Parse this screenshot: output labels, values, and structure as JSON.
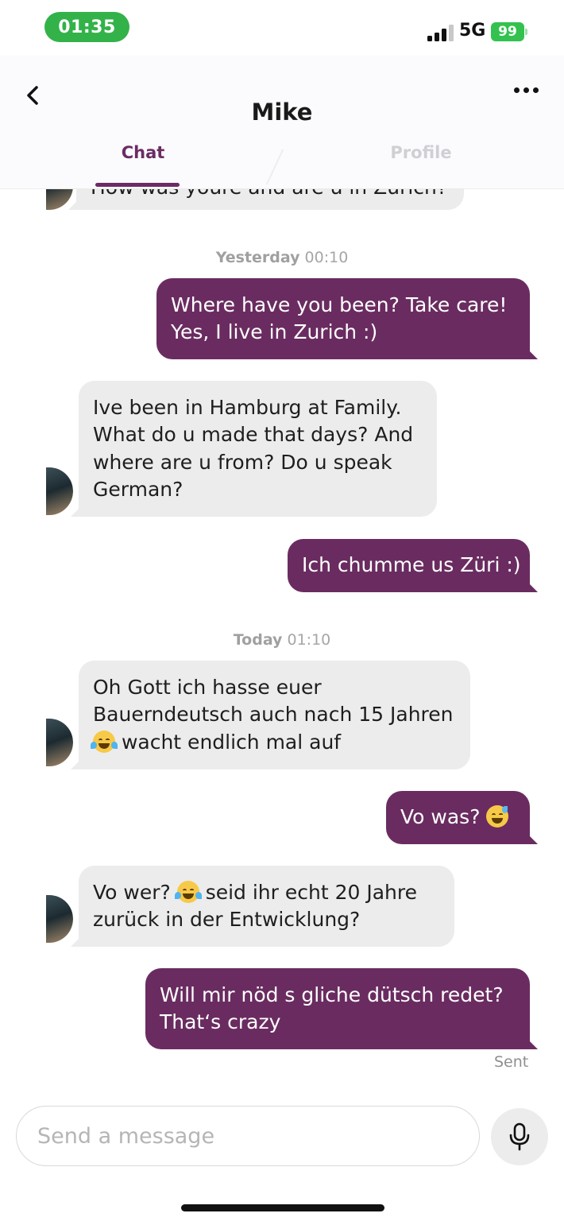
{
  "status_bar": {
    "time": "01:35",
    "network": "5G",
    "battery": "99"
  },
  "header": {
    "title": "Mike",
    "tabs": [
      {
        "label": "Chat",
        "active": true
      },
      {
        "label": "Profile",
        "active": false
      }
    ]
  },
  "timestamps": [
    {
      "day": "Yesterday",
      "time": "00:10"
    },
    {
      "day": "Today",
      "time": "01:10"
    }
  ],
  "messages": [
    {
      "from": "them",
      "lines": [
        "How was youre and are u in Zurich?"
      ]
    },
    {
      "from": "me",
      "lines": [
        "Where have you been? Take care!",
        "Yes, I live in Zurich :)"
      ]
    },
    {
      "from": "them",
      "lines": [
        "Ive been in Hamburg at Family.",
        "What do u made that days? And",
        "where are u from? Do u speak",
        "German?"
      ]
    },
    {
      "from": "me",
      "lines": [
        "Ich chumme us Züri :)"
      ]
    },
    {
      "from": "them",
      "lines": [
        "Oh Gott ich hasse euer",
        "Bauerndeutsch auch nach 15 Jahren",
        "wacht endlich mal auf"
      ],
      "emoji": "face-with-tears-of-joy"
    },
    {
      "from": "me",
      "lines": [
        "Vo was?"
      ],
      "emoji": "grinning-face-with-sweat"
    },
    {
      "from": "them",
      "lines": [
        "Vo wer?",
        "seid ihr echt 20 Jahre",
        "zurück in der Entwicklung?"
      ],
      "emoji": "face-with-tears-of-joy"
    },
    {
      "from": "me",
      "lines": [
        "Will mir nöd s gliche dütsch redet?",
        "That‘s crazy"
      ]
    }
  ],
  "delivery_status": "Sent",
  "composer": {
    "placeholder": "Send a message",
    "mic_icon": "microphone-icon"
  },
  "colors": {
    "accent": "#6a2c60",
    "incoming_bubble": "#ececec",
    "time_pill": "#33b24a"
  }
}
